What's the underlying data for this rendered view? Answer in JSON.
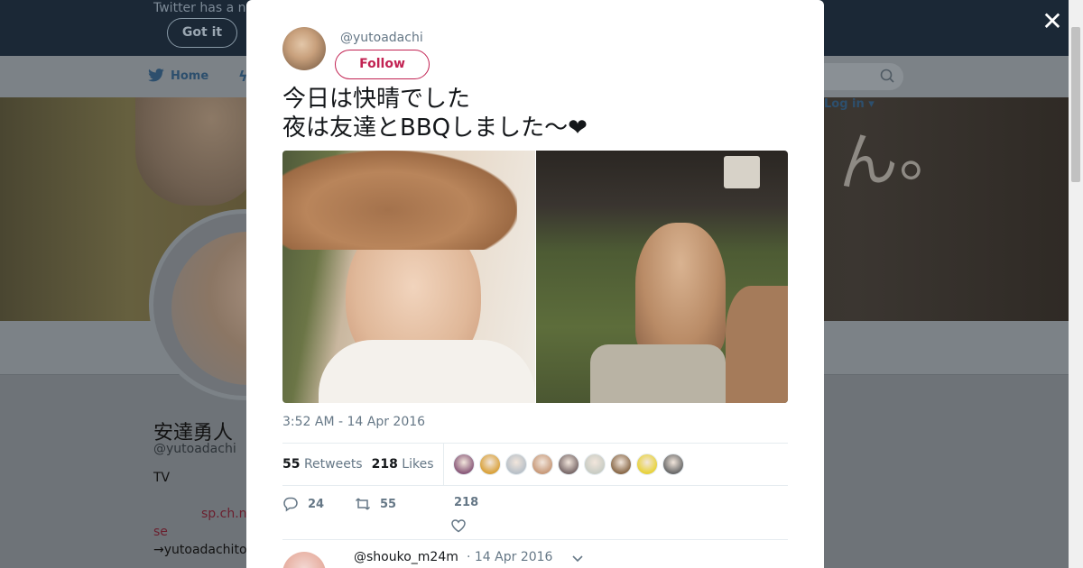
{
  "background": {
    "notice_text": "Twitter has a n",
    "got_it_label": "Got it",
    "nav_home_label": "Home",
    "login_label": "Log in",
    "profile_name": "安達勇人",
    "profile_handle": "@yutoadachi",
    "bio_line1": "TV",
    "bio_link1": "sp.ch.n",
    "bio_link2": "se",
    "bio_line3": "→yutoadachito"
  },
  "modal": {
    "close_icon": "✕",
    "author_handle": "@yutoadachi",
    "follow_label": "Follow",
    "tweet_text": "今日は快晴でした\n夜は友達とBBQしました〜❤",
    "timestamp": "3:52 AM - 14 Apr 2016",
    "retweets_count": "55",
    "retweets_label": "Retweets",
    "likes_count": "218",
    "likes_label": "Likes",
    "liker_colors": [
      "#8a5a7a",
      "#d9a13a",
      "#b8c0c8",
      "#c89a7a",
      "#7a6a6a",
      "#c8ccc4",
      "#8a6a4a",
      "#e8d23a",
      "#6a6a6a"
    ],
    "reply_count": "24",
    "retweet_action_count": "55",
    "like_action_count": "218",
    "reply": {
      "handle": "@shouko_m24m",
      "date": "· 14 Apr 2016"
    }
  },
  "colors": {
    "accent": "#c22252",
    "secondary_text": "#657786",
    "primary_text": "#14171a"
  }
}
